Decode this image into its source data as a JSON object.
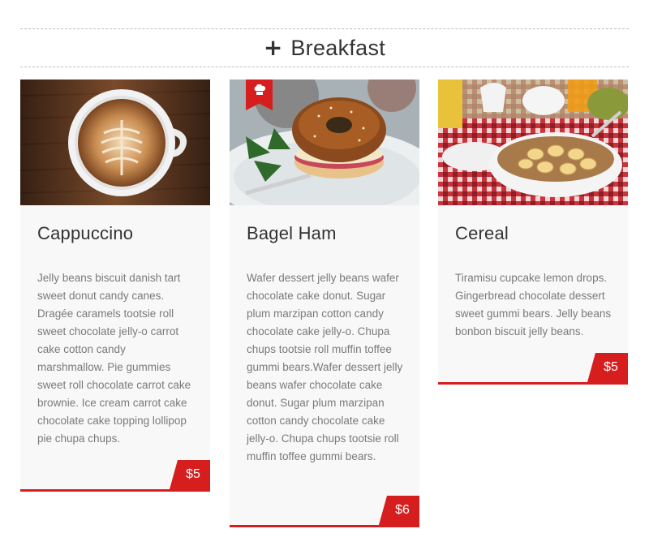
{
  "section": {
    "icon": "plus-icon",
    "title": "Breakfast"
  },
  "colors": {
    "accent": "#d71e1e",
    "card_bg": "#f8f8f8",
    "text": "#333333",
    "muted": "#7a7a7a"
  },
  "items": [
    {
      "name": "Cappuccino",
      "description": "Jelly beans biscuit danish tart sweet donut candy canes. Dragée caramels tootsie roll sweet chocolate jelly-o carrot cake cotton candy marshmallow. Pie gummies sweet roll chocolate carrot cake brownie. Ice cream carrot cake chocolate cake topping lollipop pie chupa chups.",
      "price": "$5",
      "featured": false
    },
    {
      "name": "Bagel Ham",
      "description": "Wafer dessert jelly beans wafer chocolate cake donut. Sugar plum marzipan cotton candy chocolate cake jelly-o. Chupa chups tootsie roll muffin toffee gummi bears.Wafer dessert jelly beans wafer chocolate cake donut. Sugar plum marzipan cotton candy chocolate cake jelly-o. Chupa chups tootsie roll muffin toffee gummi bears.",
      "price": "$6",
      "featured": true,
      "badge_icon": "chef-hat-icon"
    },
    {
      "name": "Cereal",
      "description": "Tiramisu cupcake lemon drops. Gingerbread chocolate dessert sweet gummi bears. Jelly beans bonbon biscuit jelly beans.",
      "price": "$5",
      "featured": false
    }
  ]
}
